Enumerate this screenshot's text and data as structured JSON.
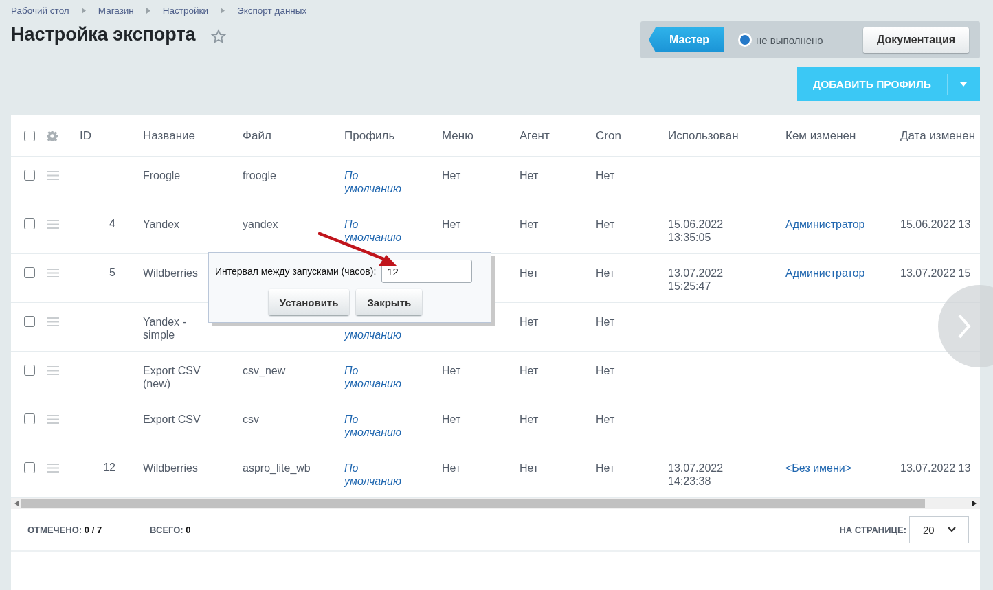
{
  "breadcrumbs": [
    "Рабочий стол",
    "Магазин",
    "Настройки",
    "Экспорт данных"
  ],
  "title": "Настройка экспорта",
  "favorite": false,
  "toolbar": {
    "master": "Мастер",
    "status": "не выполнено",
    "docs": "Документация",
    "add": "ДОБАВИТЬ ПРОФИЛЬ"
  },
  "table": {
    "header_checked": false,
    "columns": [
      "ID",
      "Название",
      "Файл",
      "Профиль",
      "Меню",
      "Агент",
      "Cron",
      "Использован",
      "Кем изменен",
      "Дата изменен"
    ],
    "rows": [
      {
        "checked": false,
        "id": "",
        "name": "Froogle",
        "file": "froogle",
        "profile": "По умолчанию",
        "menu": "Нет",
        "agent": "Нет",
        "cron": "Нет"
      },
      {
        "checked": false,
        "id": "4",
        "name": "Yandex",
        "file": "yandex",
        "profile": "По умолчанию",
        "menu": "Нет",
        "agent": "Нет",
        "cron": "Нет",
        "used": "15.06.2022 13:35:05",
        "by": "Администратор",
        "date": "15.06.2022 13"
      },
      {
        "checked": false,
        "id": "5",
        "name": "Wildberries",
        "agent": "Нет",
        "cron": "Нет",
        "used": "13.07.2022 15:25:47",
        "by": "Администратор",
        "date": "13.07.2022 15"
      },
      {
        "checked": false,
        "id": "",
        "name": "Yandex - simple",
        "profile_tail": "умолчанию",
        "agent": "Нет",
        "cron": "Нет"
      },
      {
        "checked": false,
        "id": "",
        "name": "Export CSV (new)",
        "file": "csv_new",
        "profile": "По умолчанию",
        "menu": "Нет",
        "agent": "Нет",
        "cron": "Нет"
      },
      {
        "checked": false,
        "id": "",
        "name": "Export CSV",
        "file": "csv",
        "profile": "По умолчанию",
        "menu": "Нет",
        "agent": "Нет",
        "cron": "Нет"
      },
      {
        "checked": false,
        "id": "12",
        "name": "Wildberries",
        "file": "aspro_lite_wb",
        "profile": "По умолчанию",
        "menu": "Нет",
        "agent": "Нет",
        "cron": "Нет",
        "used": "13.07.2022 14:23:38",
        "by": "<Без имени>",
        "date": "13.07.2022 13"
      }
    ]
  },
  "popup": {
    "label": "Интервал между запусками (часов):",
    "value": "12",
    "buttons": [
      "Установить",
      "Закрыть"
    ]
  },
  "footer": {
    "marked_label": "ОТМЕЧЕНО:",
    "marked": "0 / 7",
    "total_label": "ВСЕГО:",
    "total": "0",
    "per_page_label": "НА СТРАНИЦЕ:",
    "per_page": "20"
  }
}
